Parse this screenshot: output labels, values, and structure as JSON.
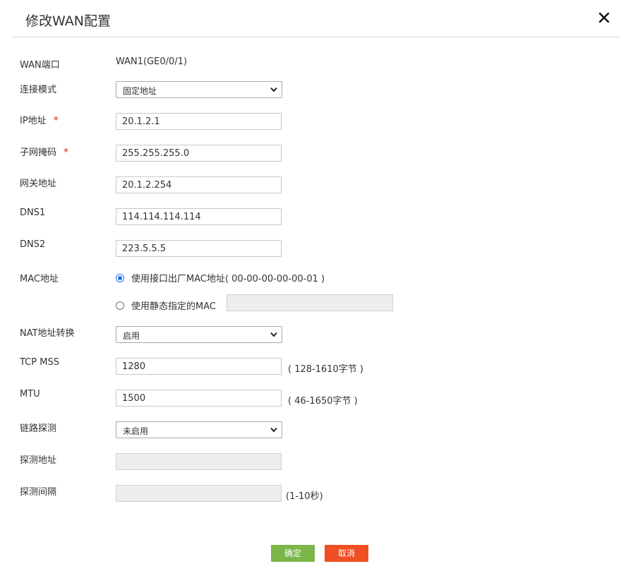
{
  "dialog": {
    "title": "修改WAN配置"
  },
  "form": {
    "wan_port": {
      "label": "WAN端口",
      "value": "WAN1(GE0/0/1)"
    },
    "conn_mode": {
      "label": "连接模式",
      "selected": "固定地址"
    },
    "ip": {
      "label": "IP地址",
      "required_mark": "*",
      "value": "20.1.2.1"
    },
    "mask": {
      "label": "子网掩码",
      "required_mark": "*",
      "value": "255.255.255.0"
    },
    "gateway": {
      "label": "网关地址",
      "value": "20.1.2.254"
    },
    "dns1": {
      "label": "DNS1",
      "value": "114.114.114.114"
    },
    "dns2": {
      "label": "DNS2",
      "value": "223.5.5.5"
    },
    "mac": {
      "label": "MAC地址",
      "option_factory": "使用接口出厂MAC地址( 00-00-00-00-00-01 )",
      "option_static": "使用静态指定的MAC",
      "static_value": "",
      "selected": "factory"
    },
    "nat": {
      "label": "NAT地址转换",
      "selected": "启用"
    },
    "tcp_mss": {
      "label": "TCP MSS",
      "value": "1280",
      "hint": "( 128-1610字节 )"
    },
    "mtu": {
      "label": "MTU",
      "value": "1500",
      "hint": "( 46-1650字节 )"
    },
    "link_detect": {
      "label": "链路探测",
      "selected": "未启用"
    },
    "detect_addr": {
      "label": "探测地址",
      "value": ""
    },
    "detect_interval": {
      "label": "探测间隔",
      "value": "",
      "hint": "(1-10秒)"
    }
  },
  "buttons": {
    "ok": "确定",
    "cancel": "取消"
  },
  "colors": {
    "ok": "#7ab648",
    "cancel": "#f04e23",
    "required": "#e02020",
    "radio_accent": "#1a73e8"
  },
  "icons": {
    "close": "close-icon",
    "dropdown": "chevron-down-icon"
  }
}
